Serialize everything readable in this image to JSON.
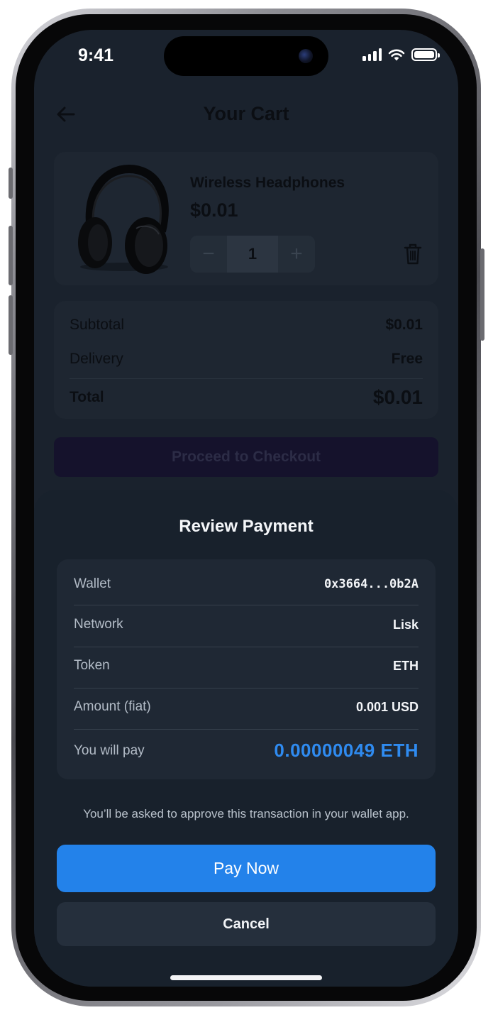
{
  "status_bar": {
    "time": "9:41",
    "icons": [
      "cellular-signal-icon",
      "wifi-icon",
      "battery-icon"
    ]
  },
  "header": {
    "title": "Your Cart",
    "back_icon": "arrow-left-icon"
  },
  "cart": {
    "item": {
      "name": "Wireless Headphones",
      "price": "$0.01",
      "quantity": "1",
      "decrement_glyph": "−",
      "increment_glyph": "+"
    },
    "summary": {
      "subtotal_label": "Subtotal",
      "subtotal_value": "$0.01",
      "delivery_label": "Delivery",
      "delivery_value": "Free",
      "total_label": "Total",
      "total_value": "$0.01"
    },
    "checkout_label": "Proceed to Checkout"
  },
  "payment_sheet": {
    "title": "Review Payment",
    "rows": [
      {
        "label": "Wallet",
        "value": "0x3664...0b2A"
      },
      {
        "label": "Network",
        "value": "Lisk"
      },
      {
        "label": "Token",
        "value": "ETH"
      },
      {
        "label": "Amount (fiat)",
        "value": "0.001 USD"
      },
      {
        "label": "You will pay",
        "value": "0.00000049 ETH"
      }
    ],
    "note": "You’ll be asked to approve this transaction in your wallet app.",
    "pay_label": "Pay Now",
    "cancel_label": "Cancel"
  },
  "colors": {
    "accent": "#2382ea",
    "highlight_text": "#2f8bf0",
    "sheet_bg": "#18212c"
  }
}
